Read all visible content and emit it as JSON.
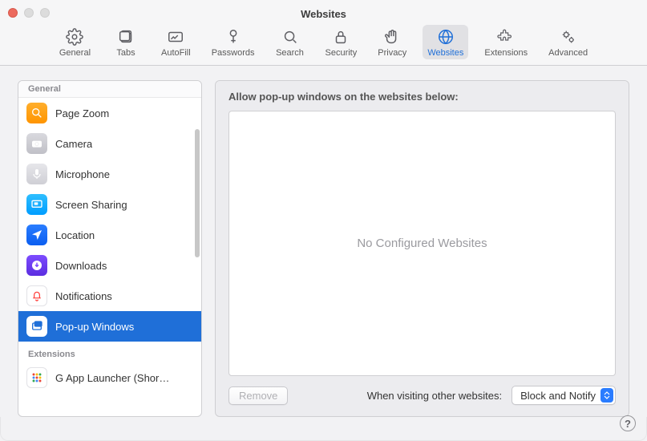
{
  "window": {
    "title": "Websites"
  },
  "toolbar": {
    "items": [
      {
        "id": "general",
        "label": "General"
      },
      {
        "id": "tabs",
        "label": "Tabs"
      },
      {
        "id": "autofill",
        "label": "AutoFill"
      },
      {
        "id": "passwords",
        "label": "Passwords"
      },
      {
        "id": "search",
        "label": "Search"
      },
      {
        "id": "security",
        "label": "Security"
      },
      {
        "id": "privacy",
        "label": "Privacy"
      },
      {
        "id": "websites",
        "label": "Websites",
        "active": true
      },
      {
        "id": "extensions",
        "label": "Extensions"
      },
      {
        "id": "advanced",
        "label": "Advanced"
      }
    ]
  },
  "sidebar": {
    "section_general": "General",
    "section_extensions": "Extensions",
    "items": [
      {
        "label": "Page Zoom"
      },
      {
        "label": "Camera"
      },
      {
        "label": "Microphone"
      },
      {
        "label": "Screen Sharing"
      },
      {
        "label": "Location"
      },
      {
        "label": "Downloads"
      },
      {
        "label": "Notifications"
      },
      {
        "label": "Pop-up Windows",
        "selected": true
      }
    ],
    "ext_items": [
      {
        "label": "G App Launcher (Shor…"
      }
    ]
  },
  "detail": {
    "header": "Allow pop-up windows on the websites below:",
    "empty": "No Configured Websites",
    "remove": "Remove",
    "visiting_label": "When visiting other websites:",
    "select_value": "Block and Notify"
  },
  "help": {
    "glyph": "?"
  }
}
